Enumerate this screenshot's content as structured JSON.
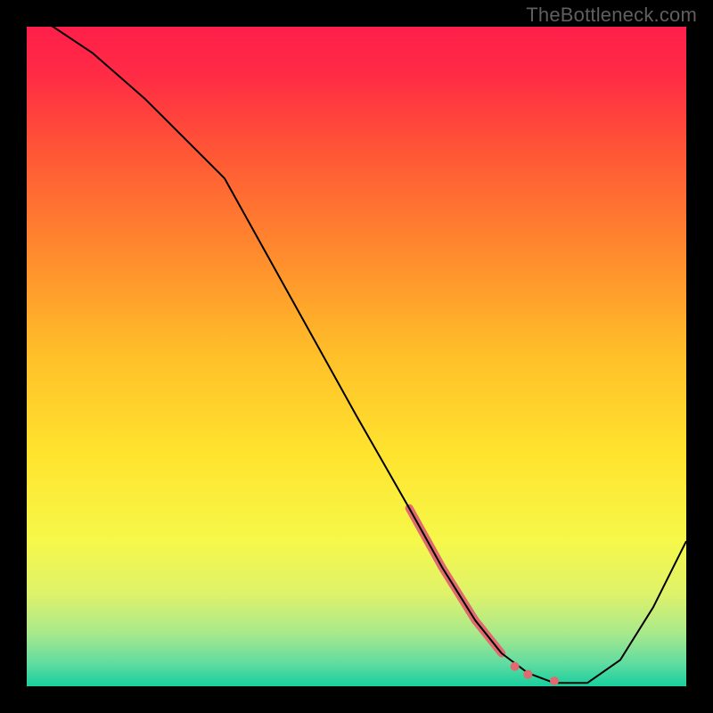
{
  "watermark": "TheBottleneck.com",
  "chart_data": {
    "type": "line",
    "title": "",
    "xlabel": "",
    "ylabel": "",
    "xlim": [
      0,
      100
    ],
    "ylim": [
      0,
      100
    ],
    "grid": false,
    "legend": false,
    "background_gradient_stops": [
      {
        "offset": 0.0,
        "color": "#ff1f4a"
      },
      {
        "offset": 0.07,
        "color": "#ff2a45"
      },
      {
        "offset": 0.2,
        "color": "#ff5a35"
      },
      {
        "offset": 0.35,
        "color": "#ff8d2d"
      },
      {
        "offset": 0.5,
        "color": "#ffc029"
      },
      {
        "offset": 0.65,
        "color": "#ffe42e"
      },
      {
        "offset": 0.78,
        "color": "#f6f84a"
      },
      {
        "offset": 0.86,
        "color": "#def26a"
      },
      {
        "offset": 0.92,
        "color": "#a8e98c"
      },
      {
        "offset": 0.965,
        "color": "#61dca0"
      },
      {
        "offset": 1.0,
        "color": "#17cf9f"
      }
    ],
    "series": [
      {
        "name": "bottleneck-curve",
        "stroke": "#000000",
        "stroke_width": 2,
        "x": [
          0,
          4,
          10,
          18,
          25,
          30,
          40,
          50,
          58,
          63,
          68,
          72,
          76,
          80,
          85,
          90,
          95,
          100
        ],
        "y": [
          102,
          100,
          96,
          89,
          82,
          77,
          59,
          41,
          27,
          18,
          10,
          5,
          2,
          0.5,
          0.5,
          4,
          12,
          22
        ]
      }
    ],
    "highlight_segment": {
      "name": "bottleneck-range",
      "stroke": "#e06a6f",
      "stroke_width": 9,
      "x": [
        58,
        63,
        68,
        72
      ],
      "y": [
        27,
        18,
        10,
        5
      ]
    },
    "highlight_dots": {
      "name": "bottleneck-points",
      "fill": "#e06a6f",
      "radius": 5,
      "points": [
        {
          "x": 74,
          "y": 3.0
        },
        {
          "x": 76,
          "y": 1.8
        },
        {
          "x": 80,
          "y": 0.8
        }
      ]
    }
  }
}
